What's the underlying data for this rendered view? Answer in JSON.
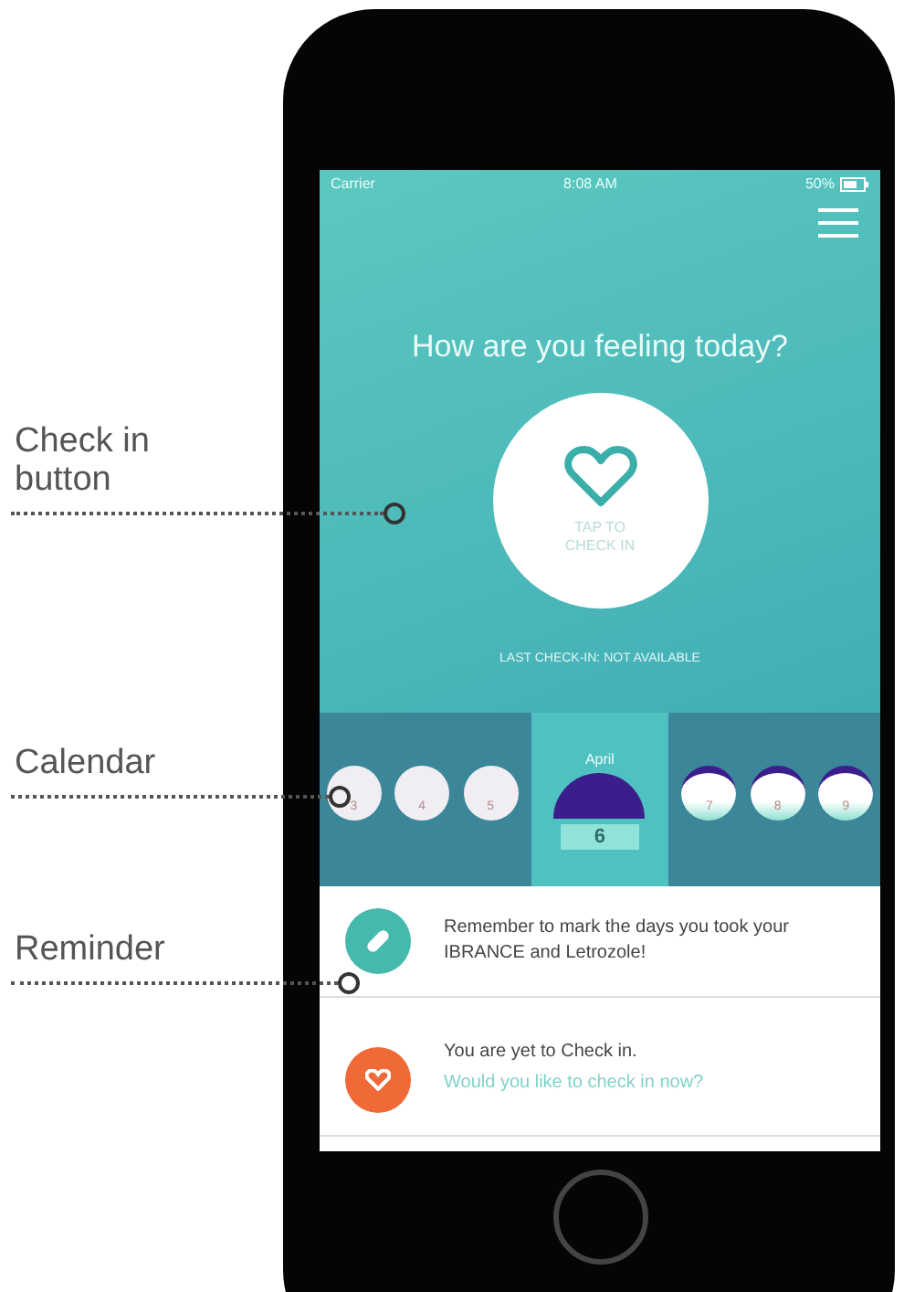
{
  "annotations": [
    {
      "label": "Check in button"
    },
    {
      "label": "Calendar"
    },
    {
      "label": "Reminder"
    }
  ],
  "status_bar": {
    "carrier": "Carrier",
    "time": "8:08 AM",
    "battery": "50%"
  },
  "title": "How are you feeling today?",
  "check_in_button": {
    "label": "TAP TO CHECK IN"
  },
  "last_check_in": "LAST CHECK-IN: NOT AVAILABLE",
  "calendar": {
    "month": "April",
    "days": [
      {
        "day": "3",
        "kind": "past",
        "selected": false
      },
      {
        "day": "4",
        "kind": "past",
        "selected": false
      },
      {
        "day": "5",
        "kind": "past",
        "selected": false
      },
      {
        "day": "6",
        "kind": "today",
        "selected": true
      },
      {
        "day": "7",
        "kind": "future",
        "selected": false
      },
      {
        "day": "8",
        "kind": "future",
        "selected": false
      },
      {
        "day": "9",
        "kind": "future",
        "selected": false
      }
    ]
  },
  "reminders": [
    {
      "kind": "medication",
      "text": "Remember to mark the days you took your IBRANCE and Letrozole!"
    },
    {
      "kind": "checkin",
      "text": "You are yet to Check in.",
      "link": "Would you like to check in now?"
    }
  ]
}
